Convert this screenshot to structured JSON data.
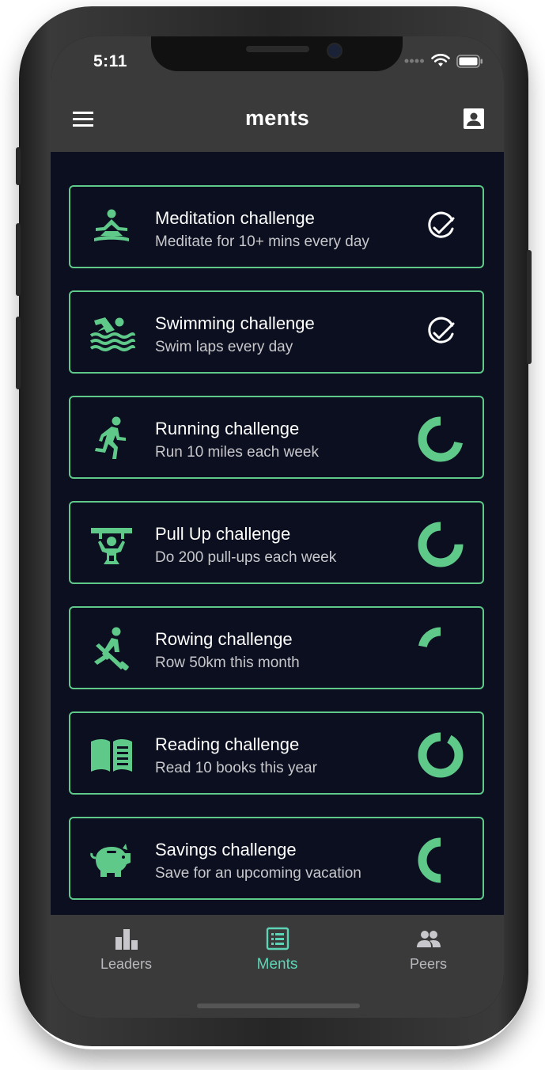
{
  "status_bar": {
    "time": "5:11"
  },
  "header": {
    "title": "ments"
  },
  "challenges": [
    {
      "title": "Meditation challenge",
      "subtitle": "Meditate for 10+ mins every day",
      "icon": "meditation-icon",
      "status": "completed"
    },
    {
      "title": "Swimming challenge",
      "subtitle": "Swim laps every day",
      "icon": "swimming-icon",
      "status": "completed"
    },
    {
      "title": "Running challenge",
      "subtitle": "Run 10 miles each week",
      "icon": "running-icon",
      "status": "in-progress",
      "progress": 0.72
    },
    {
      "title": "Pull Up challenge",
      "subtitle": "Do 200 pull-ups each week",
      "icon": "pull-up-icon",
      "status": "in-progress",
      "progress": 0.75
    },
    {
      "title": "Rowing challenge",
      "subtitle": "Row 50km this month",
      "icon": "rowing-icon",
      "status": "in-progress",
      "progress": 0.22
    },
    {
      "title": "Reading challenge",
      "subtitle": "Read 10 books this year",
      "icon": "reading-icon",
      "status": "in-progress",
      "progress": 0.92
    },
    {
      "title": "Savings challenge",
      "subtitle": "Save for an upcoming vacation",
      "icon": "piggy-bank-icon",
      "status": "in-progress",
      "progress": 0.5
    }
  ],
  "tabs": [
    {
      "label": "Leaders",
      "icon": "bar-chart-icon",
      "active": false
    },
    {
      "label": "Ments",
      "icon": "list-icon",
      "active": true
    },
    {
      "label": "Peers",
      "icon": "people-icon",
      "active": false
    }
  ],
  "colors": {
    "accent": "#5fc98a",
    "active_tab": "#5ed4b6",
    "background": "#0b0f1f",
    "bar": "#3a3a3a"
  }
}
